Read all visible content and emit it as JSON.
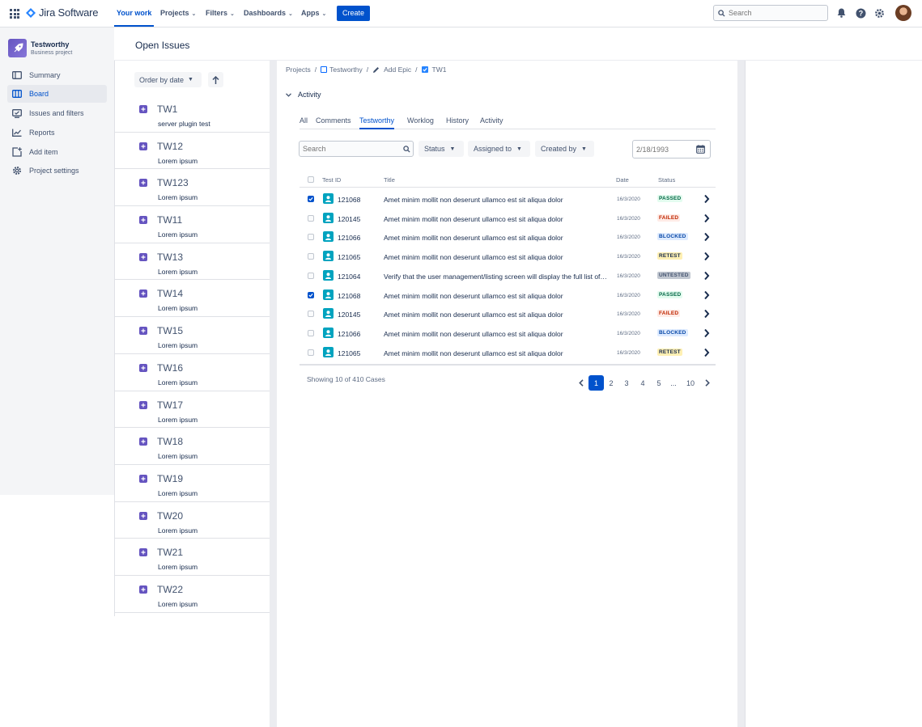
{
  "topnav": {
    "logo_text": "Jira Software",
    "items": [
      {
        "label": "Your work",
        "active": true,
        "dropdown": false
      },
      {
        "label": "Projects",
        "active": false,
        "dropdown": true
      },
      {
        "label": "Filters",
        "active": false,
        "dropdown": true
      },
      {
        "label": "Dashboards",
        "active": false,
        "dropdown": true
      },
      {
        "label": "Apps",
        "active": false,
        "dropdown": true
      }
    ],
    "create_label": "Create",
    "search_placeholder": "Search",
    "icons": [
      "bell-icon",
      "help-icon",
      "settings-icon"
    ]
  },
  "sidebar": {
    "project_name": "Testworthy",
    "project_type": "Business project",
    "items": [
      {
        "label": "Summary",
        "icon": "summary-icon",
        "active": false
      },
      {
        "label": "Board",
        "icon": "board-icon",
        "active": true
      },
      {
        "label": "Issues and filters",
        "icon": "issues-icon",
        "active": false
      },
      {
        "label": "Reports",
        "icon": "reports-icon",
        "active": false
      },
      {
        "label": "Add item",
        "icon": "add-item-icon",
        "active": false
      },
      {
        "label": "Project settings",
        "icon": "settings-icon",
        "active": false
      }
    ]
  },
  "page": {
    "title": "Open Issues"
  },
  "issues": {
    "order_label": "Order by date",
    "list": [
      {
        "key": "TW1",
        "summary": "server plugin test"
      },
      {
        "key": "TW12",
        "summary": "Lorem ipsum"
      },
      {
        "key": "TW123",
        "summary": "Lorem ipsum"
      },
      {
        "key": "TW11",
        "summary": "Lorem ipsum"
      },
      {
        "key": "TW13",
        "summary": "Lorem ipsum"
      },
      {
        "key": "TW14",
        "summary": "Lorem ipsum"
      },
      {
        "key": "TW15",
        "summary": "Lorem ipsum"
      },
      {
        "key": "TW16",
        "summary": "Lorem ipsum"
      },
      {
        "key": "TW17",
        "summary": "Lorem ipsum"
      },
      {
        "key": "TW18",
        "summary": "Lorem ipsum"
      },
      {
        "key": "TW19",
        "summary": "Lorem ipsum"
      },
      {
        "key": "TW20",
        "summary": "Lorem ipsum"
      },
      {
        "key": "TW21",
        "summary": "Lorem ipsum"
      },
      {
        "key": "TW22",
        "summary": "Lorem ipsum"
      }
    ]
  },
  "detail": {
    "breadcrumb": {
      "projects": "Projects",
      "sep": "/",
      "project": "Testworthy",
      "epic": "Add Epic",
      "issue": "TW1"
    },
    "activity_label": "Activity",
    "tabs": [
      {
        "label": "All",
        "active": false
      },
      {
        "label": "Comments",
        "active": false
      },
      {
        "label": "Testworthy",
        "active": true
      },
      {
        "label": "Worklog",
        "active": false
      },
      {
        "label": "History",
        "active": false
      },
      {
        "label": "Activity",
        "active": false
      }
    ],
    "filters": {
      "search_placeholder": "Search",
      "status": "Status",
      "assigned_to": "Assigned to",
      "created_by": "Created by",
      "date_placeholder": "2/18/1993"
    },
    "table": {
      "headers": {
        "test_id": "Test ID",
        "title": "Title",
        "date": "Date",
        "status": "Status"
      },
      "rows": [
        {
          "checked": true,
          "id": "121068",
          "title": "Amet minim mollit non deserunt ullamco est sit aliqua dolor",
          "date": "16/3/2020",
          "status": "PASSED"
        },
        {
          "checked": false,
          "id": "120145",
          "title": "Amet minim mollit non deserunt ullamco est sit aliqua dolor",
          "date": "16/3/2020",
          "status": "FAILED"
        },
        {
          "checked": false,
          "id": "121066",
          "title": "Amet minim mollit non deserunt ullamco est sit aliqua dolor",
          "date": "16/3/2020",
          "status": "BLOCKED"
        },
        {
          "checked": false,
          "id": "121065",
          "title": "Amet minim mollit non deserunt ullamco est sit aliqua dolor",
          "date": "16/3/2020",
          "status": "RETEST"
        },
        {
          "checked": false,
          "id": "121064",
          "title": "Verify that the user management/listing screen will display the full list of users",
          "date": "16/3/2020",
          "status": "UNTESTED"
        },
        {
          "checked": true,
          "id": "121068",
          "title": "Amet minim mollit non deserunt ullamco est sit aliqua dolor",
          "date": "16/3/2020",
          "status": "PASSED"
        },
        {
          "checked": false,
          "id": "120145",
          "title": "Amet minim mollit non deserunt ullamco est sit aliqua dolor",
          "date": "16/3/2020",
          "status": "FAILED"
        },
        {
          "checked": false,
          "id": "121066",
          "title": "Amet minim mollit non deserunt ullamco est sit aliqua dolor",
          "date": "16/3/2020",
          "status": "BLOCKED"
        },
        {
          "checked": false,
          "id": "121065",
          "title": "Amet minim mollit non deserunt ullamco est sit aliqua dolor",
          "date": "16/3/2020",
          "status": "RETEST"
        }
      ]
    },
    "footer": {
      "showing": "Showing 10 of 410 Cases",
      "pages": [
        "1",
        "2",
        "3",
        "4",
        "5",
        "...",
        "10"
      ],
      "current_page": "1"
    }
  },
  "status_colors": {
    "PASSED": {
      "bg": "#E3FCEF",
      "fg": "#006644"
    },
    "FAILED": {
      "bg": "#FFEBE6",
      "fg": "#BF2600"
    },
    "BLOCKED": {
      "bg": "#DEEBFF",
      "fg": "#0747A6"
    },
    "RETEST": {
      "bg": "#FFF0B3",
      "fg": "#172B4D"
    },
    "UNTESTED": {
      "bg": "#C1C7D0",
      "fg": "#42526E"
    }
  },
  "colors": {
    "accent": "#0052CC",
    "sidebar_bg": "#F4F5F7",
    "issue_icon": "#6554C0"
  }
}
